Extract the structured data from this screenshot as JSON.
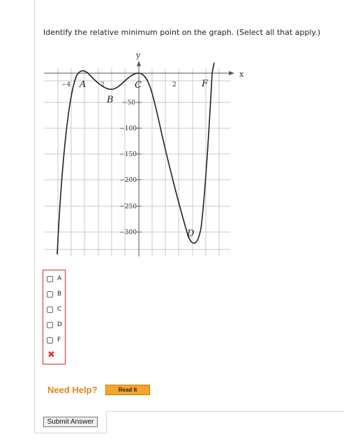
{
  "question": {
    "text": "Identify the relative minimum point on the graph. (Select all that apply.)"
  },
  "graph": {
    "axis_labels": {
      "x": "x",
      "y": "y"
    },
    "x_ticks": [
      "−4",
      "2",
      "2"
    ],
    "y_ticks": [
      "−50",
      "−100",
      "−150",
      "−200",
      "−250",
      "−300"
    ],
    "point_labels": {
      "A": "A",
      "B": "B",
      "C": "C",
      "D": "D",
      "F": "F"
    }
  },
  "choices": [
    {
      "label": "A",
      "checked": false
    },
    {
      "label": "B",
      "checked": false
    },
    {
      "label": "C",
      "checked": false
    },
    {
      "label": "D",
      "checked": false
    },
    {
      "label": "F",
      "checked": false
    }
  ],
  "result_icon": "x-mark-icon",
  "colors": {
    "error": "#e03a3a",
    "help": "#e3851b",
    "readit": "#f4a52a"
  },
  "help": {
    "need_help": "Need Help?",
    "read_it": "Read It"
  },
  "submit": {
    "label": "Submit Answer"
  }
}
